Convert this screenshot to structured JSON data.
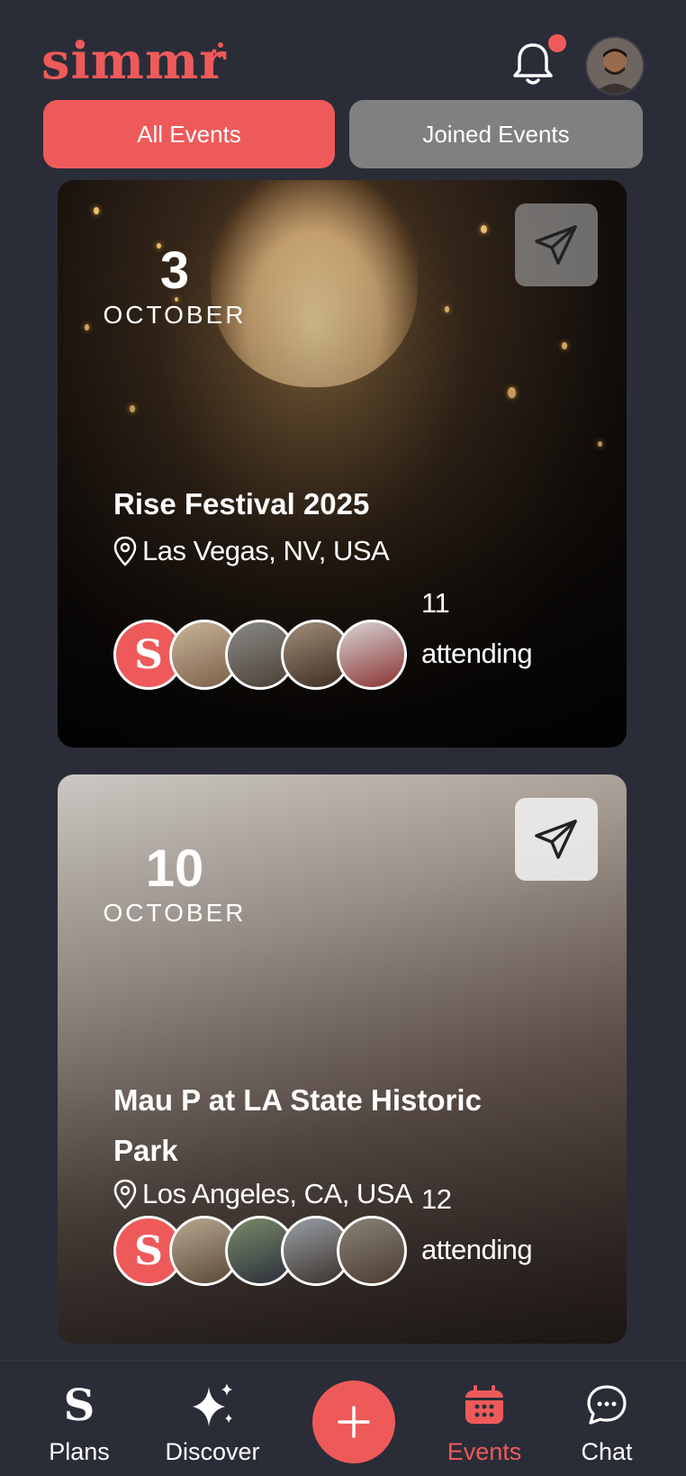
{
  "app": {
    "logo_text": "simmr",
    "accent_color": "#ee5a5a",
    "background_color": "#2a2d38"
  },
  "header": {
    "notification_icon": "bell-icon",
    "has_unread": true,
    "profile_avatar": "user-avatar"
  },
  "tabs": [
    {
      "label": "All Events",
      "active": true
    },
    {
      "label": "Joined Events",
      "active": false
    }
  ],
  "events": [
    {
      "day": "3",
      "month": "OCTOBER",
      "title": "Rise Festival 2025",
      "location": "Las Vegas, NV, USA",
      "attending_count": "11",
      "attending_label": "attending",
      "share_icon": "paper-plane-icon"
    },
    {
      "day": "10",
      "month": "OCTOBER",
      "title": "Mau P at LA State Historic Park",
      "location": "Los Angeles, CA, USA",
      "attending_count": "12",
      "attending_label": "attending",
      "share_icon": "paper-plane-icon"
    }
  ],
  "nav": {
    "items": [
      {
        "label": "Plans",
        "icon": "plans-s-icon"
      },
      {
        "label": "Discover",
        "icon": "sparkles-icon"
      },
      {
        "label": "",
        "icon": "plus-icon"
      },
      {
        "label": "Events",
        "icon": "calendar-icon",
        "active": true
      },
      {
        "label": "Chat",
        "icon": "chat-bubble-icon"
      }
    ]
  }
}
